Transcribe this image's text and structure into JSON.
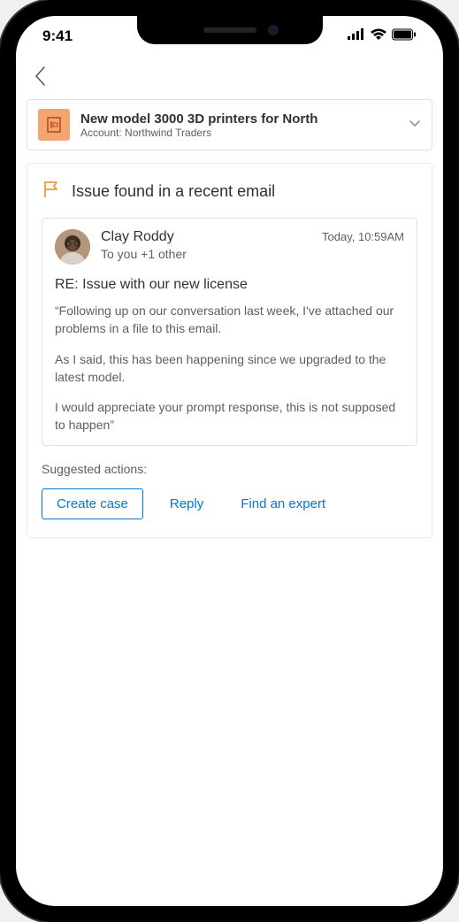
{
  "statusBar": {
    "time": "9:41"
  },
  "opportunity": {
    "title": "New model 3000 3D printers for North",
    "accountLabel": "Account: Northwind Traders"
  },
  "issueCard": {
    "heading": "Issue found in a recent email",
    "email": {
      "senderName": "Clay Roddy",
      "recipients": "To you +1 other",
      "timestamp": "Today, 10:59AM",
      "subject": "RE: Issue with our new license",
      "body_p1": "“Following up on our conversation last week, I've attached our problems in a file to this email.",
      "body_p2": "As I said, this has been happening since we upgraded to the latest model.",
      "body_p3": "I would appreciate your prompt response, this is not supposed to happen”"
    },
    "suggestedLabel": "Suggested actions:",
    "actions": {
      "createCase": "Create case",
      "reply": "Reply",
      "findExpert": "Find an expert"
    }
  }
}
